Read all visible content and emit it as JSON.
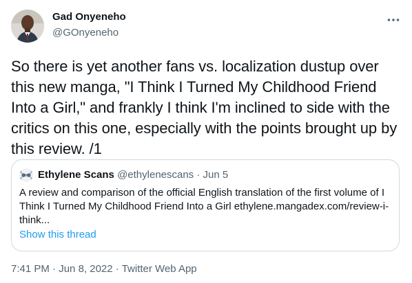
{
  "author": {
    "display_name": "Gad Onyeneho",
    "handle": "@GOnyeneho"
  },
  "icons": {
    "more": "more-horizontal-icon",
    "avatar": "user-avatar"
  },
  "tweet": {
    "text": "So there is yet another fans vs. localization dustup over this new manga, \"I Think I Turned My Childhood Friend Into a Girl,\" and frankly I think I'm inclined to side with the critics on this one, especially with the points brought up by this review. /1"
  },
  "quote": {
    "name": "Ethylene Scans",
    "handle": "@ethylenescans",
    "separator": "·",
    "date": "Jun 5",
    "text": "A review and comparison of the official English translation of the first volume of I Think I Turned My Childhood Friend Into a Girl ethylene.mangadex.com/review-i-think...",
    "show_thread": "Show this thread"
  },
  "footer": {
    "time": "7:41 PM",
    "date": "Jun 8, 2022",
    "source": "Twitter Web App",
    "separator": "·"
  },
  "colors": {
    "text": "#0f1419",
    "secondary": "#536471",
    "link": "#1d9bf0",
    "border": "#cfd9de"
  }
}
